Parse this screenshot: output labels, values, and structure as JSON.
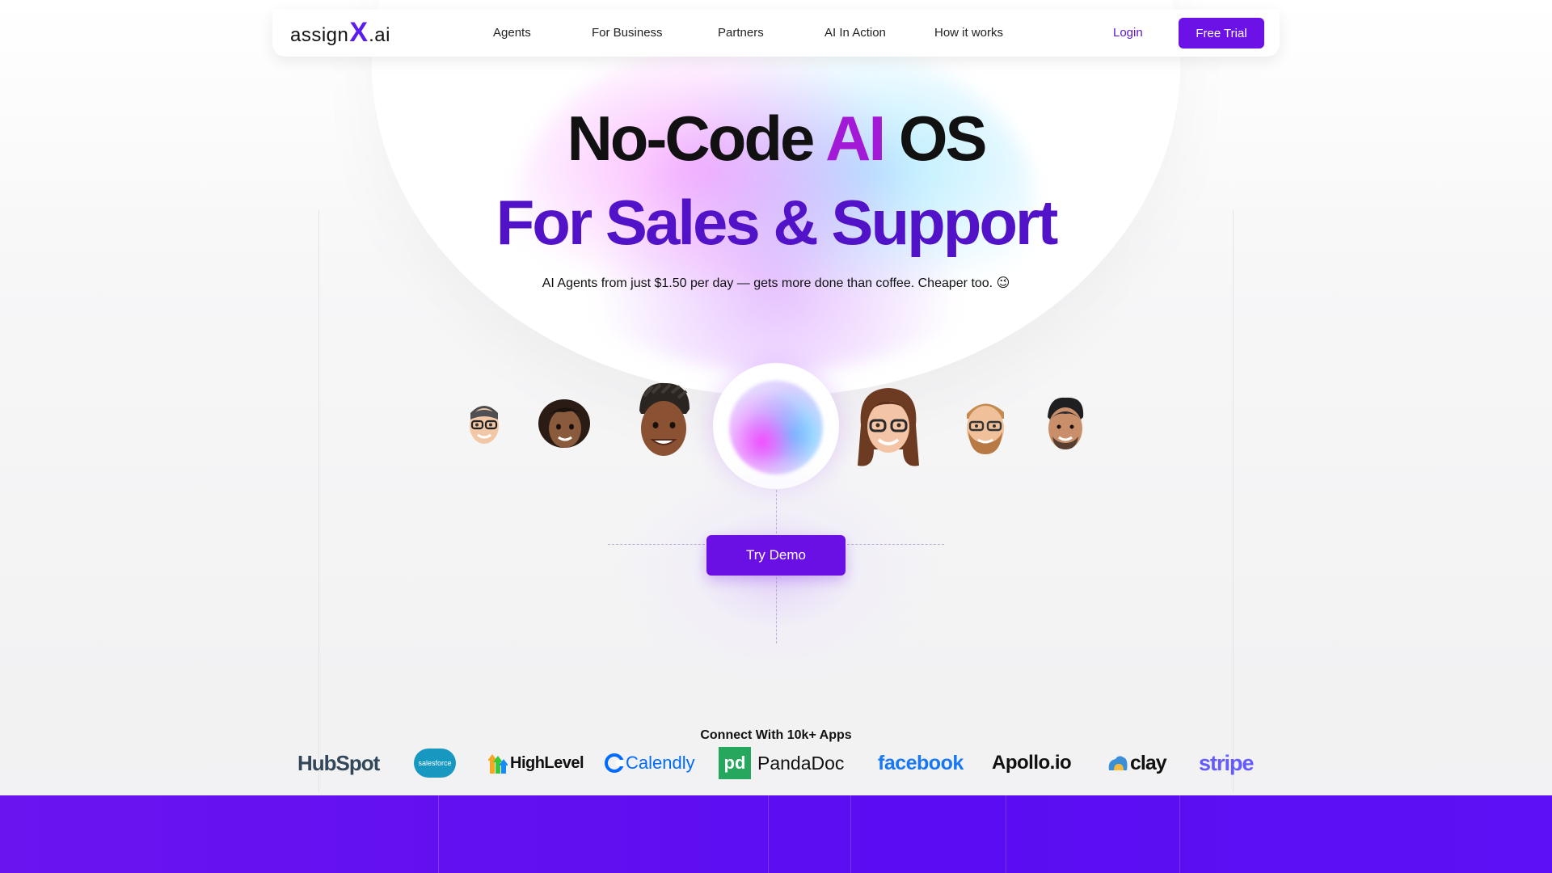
{
  "nav": {
    "logo_prefix": "assign",
    "logo_x": "X",
    "logo_suffix": ".ai",
    "links": [
      "Agents",
      "For Business",
      "Partners",
      "AI In Action",
      "How it works"
    ],
    "login": "Login",
    "free_trial": "Free Trial"
  },
  "hero": {
    "title_part1": "No-Code",
    "title_ai": "AI",
    "title_part2": "OS",
    "subtitle_line": "For Sales & Support",
    "tagline": "AI Agents from just $1.50 per day — gets more done than coffee. Cheaper too. 😉"
  },
  "demo": {
    "button": "Try Demo"
  },
  "integrations": {
    "heading": "Connect With 10k+ Apps",
    "logos": [
      "HubSpot",
      "salesforce",
      "HighLevel",
      "Calendly",
      "PandaDoc",
      "facebook",
      "Apollo.io",
      "clay",
      "stripe"
    ]
  },
  "colors": {
    "brand_purple": "#6d12e6",
    "headline_purple": "#5212c8",
    "ai_magenta": "#a21ad6"
  }
}
